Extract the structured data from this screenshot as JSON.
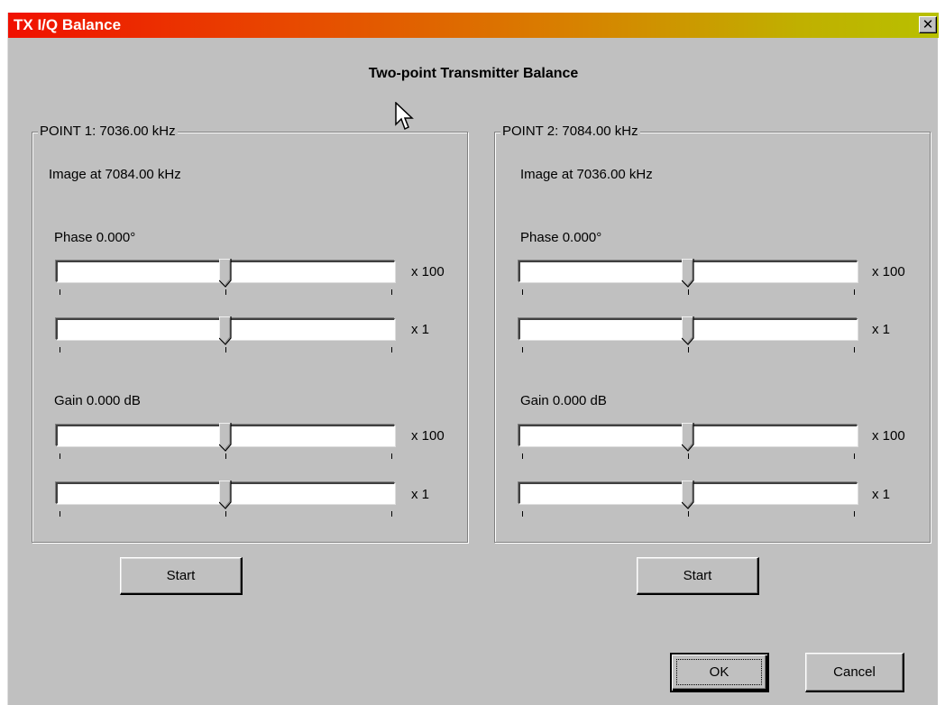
{
  "window": {
    "title": "TX I/Q Balance",
    "close_glyph": "✕"
  },
  "heading": "Two-point Transmitter Balance",
  "point1": {
    "legend": "POINT 1: 7036.00 kHz",
    "image_text": "Image at 7084.00 kHz",
    "phase_label": "Phase  0.000°",
    "gain_label": "Gain  0.000 dB",
    "phase_coarse_scale": "x 100",
    "phase_fine_scale": "x 1",
    "gain_coarse_scale": "x 100",
    "gain_fine_scale": "x 1",
    "phase_coarse_value": 0.5,
    "phase_fine_value": 0.5,
    "gain_coarse_value": 0.5,
    "gain_fine_value": 0.5,
    "start_label": "Start"
  },
  "point2": {
    "legend": "POINT 2: 7084.00 kHz",
    "image_text": "Image at 7036.00 kHz",
    "phase_label": "Phase  0.000°",
    "gain_label": "Gain  0.000 dB",
    "phase_coarse_scale": "x 100",
    "phase_fine_scale": "x 1",
    "gain_coarse_scale": "x 100",
    "gain_fine_scale": "x 1",
    "phase_coarse_value": 0.5,
    "phase_fine_value": 0.5,
    "gain_coarse_value": 0.5,
    "gain_fine_value": 0.5,
    "start_label": "Start"
  },
  "footer": {
    "ok_label": "OK",
    "cancel_label": "Cancel"
  },
  "icons": {
    "close": "close-icon",
    "cursor": "mouse-pointer-icon"
  },
  "colors": {
    "title_gradient_start": "#f01000",
    "title_gradient_end": "#b8c000",
    "dialog_face": "#c0c0c0"
  }
}
